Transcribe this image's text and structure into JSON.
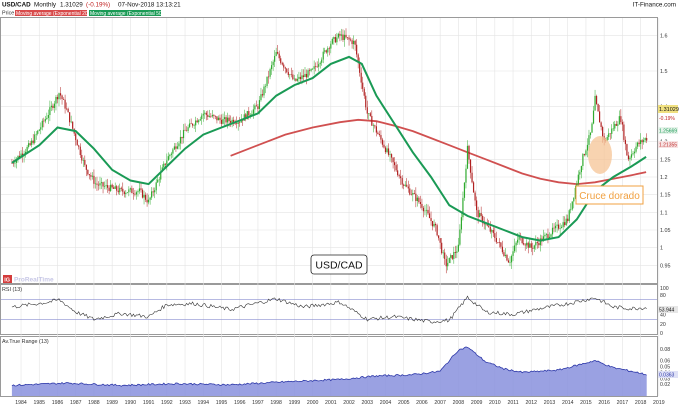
{
  "header": {
    "symbol": "USD/CAD",
    "period": "Monthly",
    "price": "1.31029",
    "change": "(-0.19%)",
    "datetime": "07-Nov-2018 13:13:21",
    "brand": "IT-Finance.com"
  },
  "legend": {
    "price": "Price",
    "ma_red": "Moving average (Exponential 200)",
    "ma_green": "Moving average (Exponential 50)"
  },
  "colors": {
    "up": "#2eaa2e",
    "down": "#b02020",
    "ema_fast": "#1a9a55",
    "ema_slow": "#d05050",
    "rsi": "#333333",
    "atr_fill": "#8890dd",
    "atr_line": "#2c37a8",
    "annotation": "#f0a040",
    "grid": "#e4e4e4"
  },
  "annotations": {
    "title_box": "USD/CAD",
    "golden_cross": "Cruce dorado",
    "logo": "ProRealTime"
  },
  "price_tags": {
    "last": "1.31029",
    "change": "-0.19%",
    "ema_fast": "1.25669",
    "ema_slow": "1.21355"
  },
  "panels": {
    "rsi_label": "RSI (13)",
    "rsi_value": "53.944",
    "atr_label": "Av.True Range (13)",
    "atr_value": "0.0363"
  },
  "chart_data": [
    {
      "type": "candlestick",
      "title": "USD/CAD",
      "ylim": [
        0.9,
        1.65
      ],
      "y_ticks": [
        "0.95",
        "1",
        "1.05",
        "1.1",
        "1.15",
        "1.2",
        "1.25",
        "1.3",
        "1.4",
        "1.5",
        "1.6"
      ],
      "y_tick_values": [
        0.95,
        1.0,
        1.05,
        1.1,
        1.15,
        1.2,
        1.25,
        1.3,
        1.4,
        1.5,
        1.6
      ],
      "x_ticks": [
        "1984",
        "1985",
        "1986",
        "1987",
        "1988",
        "1989",
        "1990",
        "1991",
        "1992",
        "1993",
        "1994",
        "1995",
        "1996",
        "1997",
        "1998",
        "1999",
        "2000",
        "2001",
        "2002",
        "2003",
        "2004",
        "2005",
        "2006",
        "2007",
        "2008",
        "2009",
        "2010",
        "2011",
        "2012",
        "2013",
        "2014",
        "2015",
        "2016",
        "2017",
        "2018",
        "2019"
      ],
      "anchors": [
        [
          1984.0,
          1.24
        ],
        [
          1985.0,
          1.29
        ],
        [
          1986.0,
          1.38
        ],
        [
          1986.6,
          1.44
        ],
        [
          1987.0,
          1.39
        ],
        [
          1988.0,
          1.23
        ],
        [
          1988.6,
          1.18
        ],
        [
          1990.0,
          1.16
        ],
        [
          1991.0,
          1.16
        ],
        [
          1991.5,
          1.13
        ],
        [
          1992.5,
          1.25
        ],
        [
          1993.5,
          1.33
        ],
        [
          1994.5,
          1.38
        ],
        [
          1995.5,
          1.36
        ],
        [
          1996.5,
          1.36
        ],
        [
          1997.5,
          1.4
        ],
        [
          1998.5,
          1.55
        ],
        [
          1999.5,
          1.47
        ],
        [
          2000.5,
          1.5
        ],
        [
          2001.5,
          1.58
        ],
        [
          2002.0,
          1.6
        ],
        [
          2002.8,
          1.58
        ],
        [
          2003.5,
          1.38
        ],
        [
          2004.5,
          1.28
        ],
        [
          2005.5,
          1.18
        ],
        [
          2006.5,
          1.12
        ],
        [
          2007.3,
          1.05
        ],
        [
          2007.8,
          0.95
        ],
        [
          2008.5,
          1.0
        ],
        [
          2009.0,
          1.28
        ],
        [
          2009.5,
          1.1
        ],
        [
          2010.5,
          1.03
        ],
        [
          2011.3,
          0.96
        ],
        [
          2011.8,
          1.03
        ],
        [
          2012.5,
          1.0
        ],
        [
          2013.5,
          1.04
        ],
        [
          2014.5,
          1.08
        ],
        [
          2015.3,
          1.25
        ],
        [
          2015.8,
          1.33
        ],
        [
          2016.0,
          1.42
        ],
        [
          2016.5,
          1.3
        ],
        [
          2017.0,
          1.34
        ],
        [
          2017.4,
          1.37
        ],
        [
          2017.8,
          1.25
        ],
        [
          2018.3,
          1.29
        ],
        [
          2018.8,
          1.31
        ]
      ],
      "ema_fast": [
        [
          1984.0,
          1.24
        ],
        [
          1985.5,
          1.29
        ],
        [
          1986.5,
          1.34
        ],
        [
          1987.5,
          1.33
        ],
        [
          1988.5,
          1.28
        ],
        [
          1989.5,
          1.22
        ],
        [
          1990.5,
          1.19
        ],
        [
          1991.5,
          1.18
        ],
        [
          1992.5,
          1.23
        ],
        [
          1993.5,
          1.28
        ],
        [
          1994.5,
          1.32
        ],
        [
          1995.5,
          1.34
        ],
        [
          1996.5,
          1.36
        ],
        [
          1997.5,
          1.38
        ],
        [
          1998.5,
          1.43
        ],
        [
          1999.5,
          1.46
        ],
        [
          2000.5,
          1.48
        ],
        [
          2001.5,
          1.52
        ],
        [
          2002.5,
          1.54
        ],
        [
          2003.2,
          1.52
        ],
        [
          2004.0,
          1.43
        ],
        [
          2005.0,
          1.35
        ],
        [
          2006.0,
          1.27
        ],
        [
          2007.0,
          1.2
        ],
        [
          2008.0,
          1.12
        ],
        [
          2009.0,
          1.09
        ],
        [
          2010.0,
          1.07
        ],
        [
          2011.0,
          1.05
        ],
        [
          2012.0,
          1.03
        ],
        [
          2013.0,
          1.02
        ],
        [
          2014.0,
          1.03
        ],
        [
          2015.0,
          1.08
        ],
        [
          2016.0,
          1.16
        ],
        [
          2017.0,
          1.2
        ],
        [
          2018.0,
          1.23
        ],
        [
          2018.8,
          1.257
        ]
      ],
      "ema_slow": [
        [
          1996.0,
          1.26
        ],
        [
          1997.5,
          1.29
        ],
        [
          1999.0,
          1.32
        ],
        [
          2000.5,
          1.34
        ],
        [
          2002.0,
          1.355
        ],
        [
          2003.0,
          1.362
        ],
        [
          2004.0,
          1.358
        ],
        [
          2005.0,
          1.345
        ],
        [
          2006.0,
          1.33
        ],
        [
          2007.0,
          1.31
        ],
        [
          2008.0,
          1.29
        ],
        [
          2009.0,
          1.27
        ],
        [
          2010.0,
          1.25
        ],
        [
          2011.0,
          1.23
        ],
        [
          2012.0,
          1.21
        ],
        [
          2013.0,
          1.195
        ],
        [
          2014.0,
          1.185
        ],
        [
          2015.0,
          1.18
        ],
        [
          2016.0,
          1.185
        ],
        [
          2017.0,
          1.195
        ],
        [
          2018.0,
          1.205
        ],
        [
          2018.8,
          1.214
        ]
      ]
    },
    {
      "type": "line",
      "title": "RSI (13)",
      "ylim": [
        0,
        100
      ],
      "y_ticks": [
        "100",
        "80",
        "40",
        "20",
        "0"
      ],
      "y_tick_values": [
        100,
        80,
        40,
        20,
        0
      ],
      "levels": [
        70,
        30
      ],
      "series": [
        [
          1984.0,
          55
        ],
        [
          1985.0,
          60
        ],
        [
          1986.0,
          65
        ],
        [
          1986.6,
          70
        ],
        [
          1987.5,
          45
        ],
        [
          1988.5,
          30
        ],
        [
          1990.0,
          42
        ],
        [
          1991.5,
          35
        ],
        [
          1992.5,
          60
        ],
        [
          1994.0,
          62
        ],
        [
          1996.0,
          50
        ],
        [
          1998.5,
          72
        ],
        [
          2000.0,
          55
        ],
        [
          2002.0,
          65
        ],
        [
          2003.5,
          30
        ],
        [
          2005.0,
          35
        ],
        [
          2007.0,
          25
        ],
        [
          2008.0,
          28
        ],
        [
          2009.0,
          75
        ],
        [
          2010.0,
          45
        ],
        [
          2011.5,
          40
        ],
        [
          2013.0,
          52
        ],
        [
          2014.5,
          62
        ],
        [
          2016.0,
          74
        ],
        [
          2017.0,
          55
        ],
        [
          2018.0,
          52
        ],
        [
          2018.8,
          54
        ]
      ]
    },
    {
      "type": "area",
      "title": "Av.True Range (13)",
      "ylim": [
        0,
        0.1
      ],
      "y_ticks": [
        "0.08",
        "0.06",
        "0.05",
        "0.04",
        "0.03",
        "0.02"
      ],
      "y_tick_values": [
        0.08,
        0.06,
        0.05,
        0.04,
        0.03,
        0.02
      ],
      "series": [
        [
          1984.0,
          0.018
        ],
        [
          1987.0,
          0.022
        ],
        [
          1990.0,
          0.018
        ],
        [
          1993.0,
          0.021
        ],
        [
          1996.0,
          0.019
        ],
        [
          1999.0,
          0.024
        ],
        [
          2002.0,
          0.028
        ],
        [
          2004.0,
          0.034
        ],
        [
          2006.0,
          0.036
        ],
        [
          2007.5,
          0.042
        ],
        [
          2008.5,
          0.078
        ],
        [
          2009.0,
          0.083
        ],
        [
          2010.0,
          0.058
        ],
        [
          2011.0,
          0.046
        ],
        [
          2012.0,
          0.04
        ],
        [
          2014.0,
          0.044
        ],
        [
          2016.0,
          0.06
        ],
        [
          2017.0,
          0.048
        ],
        [
          2018.0,
          0.042
        ],
        [
          2018.8,
          0.0363
        ]
      ]
    }
  ]
}
